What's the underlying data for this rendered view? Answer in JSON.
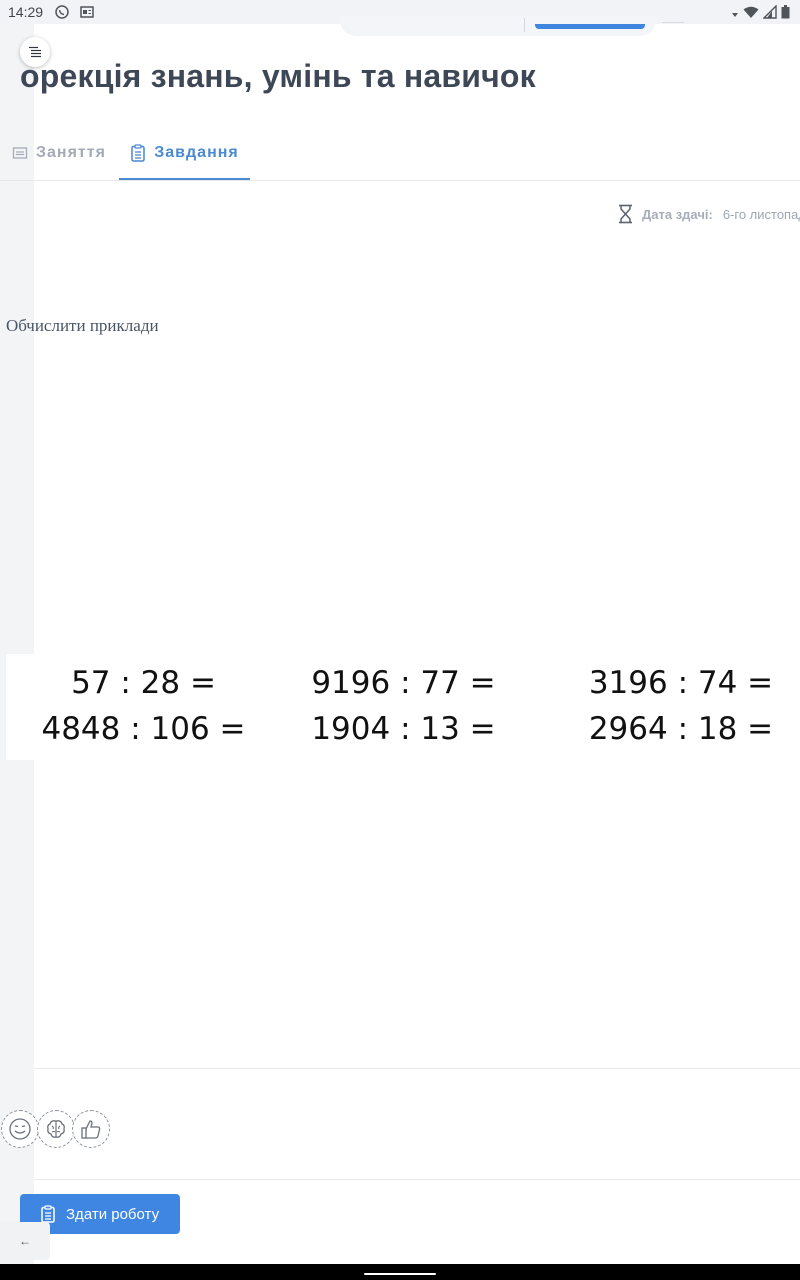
{
  "status_bar": {
    "time": "14:29"
  },
  "page": {
    "title": "орекція знань, умінь та навичок"
  },
  "tabs": [
    {
      "label": "Заняття",
      "active": false,
      "icon": "calendar-icon"
    },
    {
      "label": "Завдання",
      "active": true,
      "icon": "clipboard-icon"
    }
  ],
  "assignment": {
    "due_label": "Дата здачі:",
    "due_value": "6-го листопад",
    "text": "Обчислити приклади",
    "examples": [
      [
        "57 : 28 =",
        "4848 : 106 ="
      ],
      [
        "9196 : 77 =",
        "1904 : 13 ="
      ],
      [
        "3196 : 74 =",
        "2964 : 18 ="
      ]
    ]
  },
  "reactions": [
    "smile-icon",
    "brain-icon",
    "thumbs-up-icon"
  ],
  "actions": {
    "submit_label": "Здати роботу",
    "back_label": "←"
  },
  "colors": {
    "accent": "#3e86e2",
    "active_tab": "#4b89d1",
    "title": "#3d4756",
    "muted": "#a4abb6"
  }
}
